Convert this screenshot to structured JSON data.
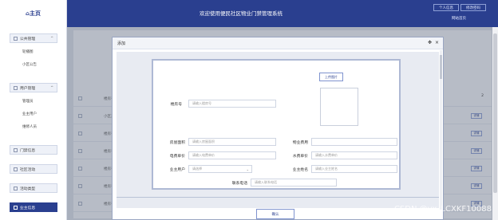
{
  "header": {
    "logo": "⌂主页",
    "title": "欢迎使用便民社区物业门禁管理系统",
    "btn_personal": "个人信息",
    "btn_password": "修改密码",
    "link_home": "网站首页"
  },
  "sidebar": {
    "groups": [
      {
        "label": "公共管理",
        "chev": "^"
      },
      {
        "label": "用户管理",
        "chev": "^"
      },
      {
        "label": "门禁信息"
      },
      {
        "label": "社区活动"
      },
      {
        "label": "活动类型"
      },
      {
        "label": "业主信息"
      }
    ],
    "subs": [
      "轮播图",
      "小区公告",
      "管理员",
      "业主用户",
      "维修人员"
    ]
  },
  "background_table": {
    "rows": [
      {
        "text": "楼房号"
      },
      {
        "text": "小区某某楼"
      },
      {
        "text": "楼房号"
      },
      {
        "text": "楼房号"
      },
      {
        "text": "楼房号"
      },
      {
        "text": "楼房号"
      },
      {
        "text": "楼房号"
      }
    ],
    "row_btn": "详情",
    "pager_text": "2"
  },
  "modal": {
    "title": "添加",
    "move_icon": "✥",
    "close_icon": "×",
    "upload_button": "上传图片",
    "fields": {
      "building_no": {
        "label": "楼房号",
        "placeholder": "请输入楼房号"
      },
      "area": {
        "label": "房屋面积",
        "placeholder": "请输入房屋面积"
      },
      "property_fee": {
        "label": "物业费用",
        "placeholder": ""
      },
      "electric_price": {
        "label": "电费单价",
        "placeholder": "请输入电费单价"
      },
      "water_price": {
        "label": "水费单价",
        "placeholder": "请输入水费单价"
      },
      "owner_user": {
        "label": "业主用户",
        "value": "请选择"
      },
      "owner_name": {
        "label": "业主姓名",
        "placeholder": "请输入业主姓名"
      },
      "phone": {
        "label": "联系电话",
        "placeholder": "请输入联系电话"
      }
    },
    "confirm": "确认"
  },
  "watermark": "CSDN @vx_LCXKF10088"
}
